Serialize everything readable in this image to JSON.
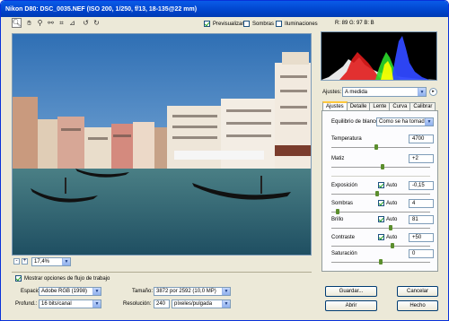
{
  "window": {
    "title": "Nikon D80:  DSC_0035.NEF  (ISO 200, 1/250, f/13, 18-135@22 mm)"
  },
  "toolbar": {
    "tools": [
      "zoom-icon",
      "hand-icon",
      "eyedropper-icon",
      "color-sampler-icon",
      "crop-icon",
      "straighten-icon",
      "rotate-ccw-icon",
      "rotate-cw-icon"
    ],
    "preview_label": "Previsualizar",
    "preview_checked": true,
    "shadows_label": "Sombras",
    "shadows_checked": false,
    "highlights_label": "Iluminaciones",
    "highlights_checked": false,
    "rgb_readout": "R:  89   G:  97   B:  B"
  },
  "zoom": {
    "minus": "-",
    "plus": "+",
    "value": "17,4%"
  },
  "workflow": {
    "toggle_label": "Mostrar opciones de flujo de trabajo",
    "toggle_checked": true,
    "space_label": "Espacio:",
    "space_value": "Adobe RGB (1998)",
    "depth_label": "Profund.:",
    "depth_value": "16 bits/canal",
    "size_label": "Tamaño:",
    "size_value": "3872 por 2592  (10,0 MP)",
    "res_label": "Resolución:",
    "res_value": "240",
    "res_unit": "píxeles/pulgada"
  },
  "settings": {
    "label": "Ajustes:",
    "value": "A medida",
    "tabs": [
      "Ajustes",
      "Detalle",
      "Lente",
      "Curva",
      "Calibrar"
    ],
    "active_tab": 0
  },
  "adjust": {
    "wb_label": "Equilibrio de blancos:",
    "wb_value": "Como se ha tomado",
    "auto_label": "Auto",
    "rows": [
      {
        "label": "Temperatura",
        "value": "4700",
        "pos": 0.45,
        "auto": false
      },
      {
        "label": "Matiz",
        "value": "+2",
        "pos": 0.52,
        "auto": false
      },
      {
        "label": "Exposición",
        "value": "-0,15",
        "pos": 0.46,
        "auto": true
      },
      {
        "label": "Sombras",
        "value": "4",
        "pos": 0.05,
        "auto": true
      },
      {
        "label": "Brillo",
        "value": "81",
        "pos": 0.6,
        "auto": true
      },
      {
        "label": "Contraste",
        "value": "+50",
        "pos": 0.62,
        "auto": true
      },
      {
        "label": "Saturación",
        "value": "0",
        "pos": 0.5,
        "auto": false
      }
    ]
  },
  "buttons": {
    "save": "Guardar...",
    "cancel": "Cancelar",
    "open": "Abrir",
    "done": "Hecho"
  },
  "colors": {
    "accent": "#0044cc",
    "slider_thumb": "#5b8e2d",
    "tab_highlight": "#ffc83c"
  }
}
